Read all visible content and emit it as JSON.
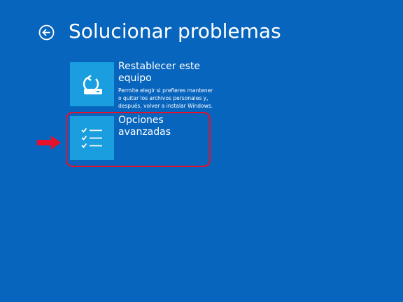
{
  "header": {
    "title": "Solucionar problemas",
    "back_icon": "back-arrow-circle-icon"
  },
  "options": [
    {
      "title": "Restablecer este equipo",
      "description": "Permite elegir si prefieres mantener o quitar los archivos personales y, después, volver a instalar Windows.",
      "icon": "reset-pc-icon"
    },
    {
      "title": "Opciones avanzadas",
      "description": "",
      "icon": "checklist-icon"
    }
  ],
  "annotation": {
    "highlight_color": "#e8112c",
    "arrow_icon": "red-arrow-right-icon"
  },
  "colors": {
    "background": "#0765be",
    "tile": "#1b9ee0",
    "text": "#ffffff"
  }
}
